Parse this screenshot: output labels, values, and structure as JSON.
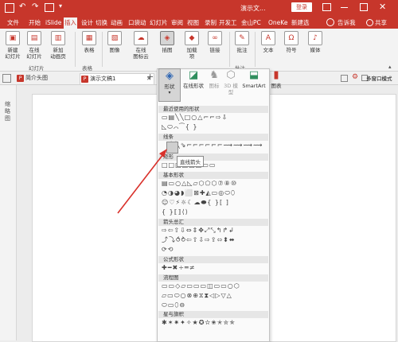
{
  "titlebar": {
    "title": "演示文...",
    "login_label": "登录",
    "colors": {
      "brand": "#c7362b"
    }
  },
  "ribbon_tabs": [
    {
      "label": "文件"
    },
    {
      "label": "开始"
    },
    {
      "label": "iSlide"
    },
    {
      "label": "插入",
      "active": true
    },
    {
      "label": "设计"
    },
    {
      "label": "切换"
    },
    {
      "label": "动画"
    },
    {
      "label": "口袋动"
    },
    {
      "label": "幻灯片"
    },
    {
      "label": "审阅"
    },
    {
      "label": "视图"
    },
    {
      "label": "录制"
    },
    {
      "label": "开发工"
    },
    {
      "label": "金山PC"
    },
    {
      "label": "OneKe"
    },
    {
      "label": "新建选"
    },
    {
      "label": "告诉我"
    }
  ],
  "share_label": "共享",
  "ribbon_buttons": {
    "new_slide": "新建\n幻灯片",
    "online_slide": "在线\n幻灯片",
    "new_anim": "新加\n动画页",
    "table": "表格",
    "image": "图像",
    "online_icons": "在线\n图标云",
    "illustrations": "插图",
    "addins": "加载\n项",
    "links": "链接",
    "comment": "批注",
    "text": "文本",
    "symbols": "符号",
    "media": "媒体"
  },
  "ribbon_groups": {
    "slides": "幻灯片",
    "tables": "表格",
    "comments": "批注"
  },
  "doc_tabs": [
    {
      "label": "简介头图"
    },
    {
      "label": "演示文稿1",
      "active": true
    }
  ],
  "add_tab": "+",
  "multi_window": "多窗口模式",
  "left_panel_label": "缩略图",
  "illustrations_dropdown": {
    "shapes": "形状",
    "online_shapes": "在线形状",
    "icons": "图标",
    "model3d": "3D 模型",
    "smartart": "SmartArt",
    "chart": "图表"
  },
  "shapes_panel": {
    "sections": [
      {
        "title": "最近使用的形状",
        "rows": [
          "▭▤╲╲□○△⌐⌐⇨⇩",
          "◺⬭⌒⁀{ }"
        ]
      },
      {
        "title": "线条",
        "rows": [
          "╲╲⇘⌐⌐⌐⌐⌐⌐⟿⟿⟿⟿"
        ]
      },
      {
        "title": "矩形",
        "rows": [
          "□□□□□□▭▭"
        ]
      },
      {
        "title": "基本形状",
        "rows": [
          "▤▭○△◺▱⬡⬠⬡⑦⑧⑩",
          "◔◑◕◗⬜⊠✚◭▭◎⬭⬯",
          "☺♡⚡☼☾☁⬬{ }[ ]",
          "{ }⟦⟧⟨⟩"
        ]
      },
      {
        "title": "箭头总汇",
        "rows": [
          "⇨⇦⇧⇩⇔⇕✥⤢⤡↰↱↲",
          "⤴⤵⥀⥁⇦⇧⇩⇨⇪⬄⬍⬌",
          "⟳⟲"
        ]
      },
      {
        "title": "公式形状",
        "rows": [
          "✚━✖÷═≠"
        ]
      },
      {
        "title": "流程图",
        "rows": [
          "▭▭◇▱▭▭▭◫▭▭○⬡",
          "▱▭⬭○⊗⊕⧖⧗◁▷▽△",
          "⬭▭⬯⊖"
        ]
      },
      {
        "title": "星与旗帜",
        "rows": [
          "✱✶✷✦✧★✪✫✬✭✮✯"
        ]
      }
    ],
    "tooltip": "直线箭头"
  }
}
